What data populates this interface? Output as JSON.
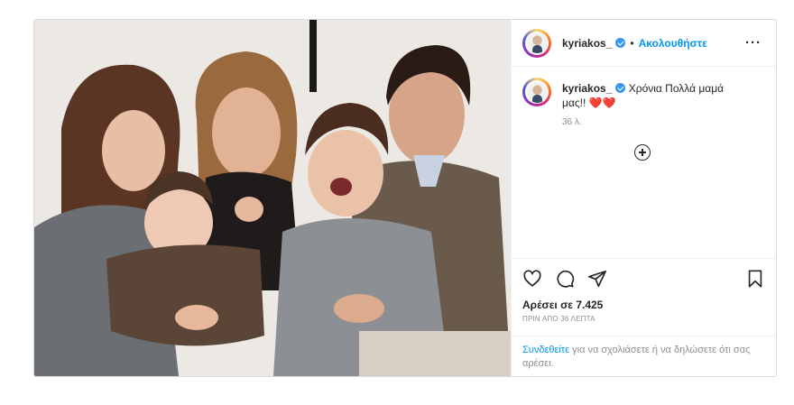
{
  "post": {
    "photo": {
      "alt_icon": "family-photo",
      "colors": {
        "background": "#e9e6e2",
        "sweater_gray": "#6d6f72",
        "jumper_brown": "#5a4536",
        "hair_dark": "#3a2418"
      }
    },
    "header": {
      "username": "kyriakos_",
      "dot": "•",
      "follow_label": "Ακολουθήστε",
      "more_label": "···"
    },
    "caption": {
      "username": "kyriakos_",
      "text": "Χρόνια Πολλά μαμά μας!!",
      "emoji": "❤️❤️",
      "time_ago": "36 λ."
    },
    "actions": {
      "icons": [
        "heart-icon",
        "comment-icon",
        "share-icon",
        "bookmark-icon"
      ]
    },
    "likes": "Αρέσει σε 7.425",
    "timestamp": "ΠΡΙΝ ΑΠΟ 36 ΛΕΠΤΑ",
    "login_prompt": {
      "link": "Συνδεθείτε",
      "rest": " για να σχολιάσετε ή να δηλώσετε ότι σας αρέσει."
    },
    "colors": {
      "accent": "#0095f6",
      "verified": "#3897f0",
      "heart": "#e0245e",
      "border": "#dbdbdb"
    }
  }
}
